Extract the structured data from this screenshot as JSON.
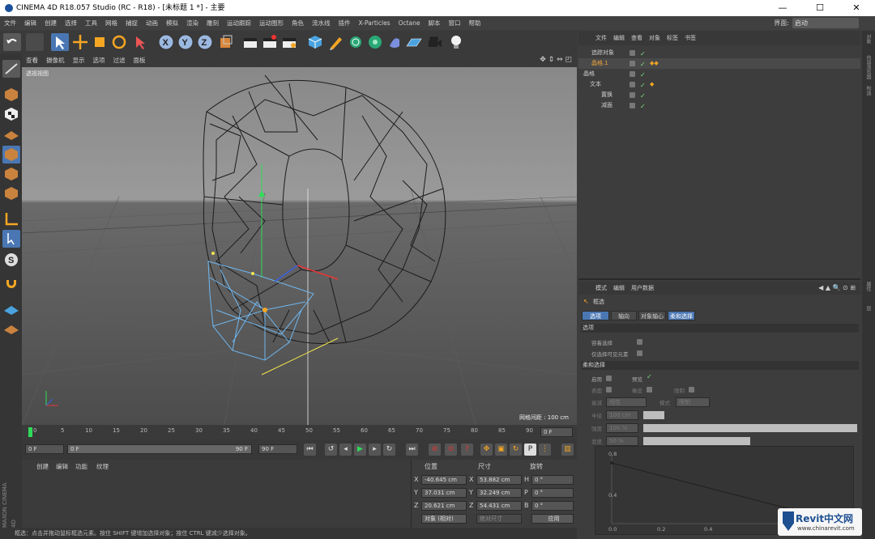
{
  "titlebar": {
    "title": "CINEMA 4D R18.057 Studio (RC - R18) - [未标题 1 *] - 主要",
    "minimize": "—",
    "maximize": "☐",
    "close": "✕"
  },
  "menubar": {
    "items": [
      "文件",
      "编辑",
      "创建",
      "选择",
      "工具",
      "网格",
      "捕捉",
      "动画",
      "模拟",
      "渲染",
      "雕刻",
      "运动跟踪",
      "运动图形",
      "角色",
      "流水线",
      "插件",
      "X-Particles",
      "Octane",
      "脚本",
      "窗口",
      "帮助"
    ],
    "interface_label": "界面:",
    "interface_value": "启动"
  },
  "viewport": {
    "menu": [
      "查看",
      "摄像机",
      "显示",
      "选项",
      "过滤",
      "面板"
    ],
    "label": "透视视图",
    "grid_spacing": "网格间距 : 100 cm"
  },
  "timeline": {
    "ticks": [
      "0",
      "5",
      "10",
      "15",
      "20",
      "25",
      "30",
      "35",
      "40",
      "45",
      "50",
      "55",
      "60",
      "65",
      "70",
      "75",
      "80",
      "85",
      "90"
    ],
    "current": "0 F"
  },
  "playback": {
    "start": "0 F",
    "range_start": "0 F",
    "range_end": "90 F",
    "end": "90 F"
  },
  "material": {
    "menu": [
      "创建",
      "编辑",
      "功能",
      "纹理"
    ]
  },
  "coordinates": {
    "headers": [
      "位置",
      "尺寸",
      "旋转"
    ],
    "rows": [
      {
        "a": "X",
        "pos": "-40.645 cm",
        "b": "X",
        "size": "53.882 cm",
        "c": "H",
        "rot": "0 °"
      },
      {
        "a": "Y",
        "pos": "37.031 cm",
        "b": "Y",
        "size": "32.249 cm",
        "c": "P",
        "rot": "0 °"
      },
      {
        "a": "Z",
        "pos": "20.621 cm",
        "b": "Z",
        "size": "54.431 cm",
        "c": "B",
        "rot": "0 °"
      }
    ],
    "mode": "对象 (相对)",
    "size_mode": "绝对尺寸",
    "apply": "应用"
  },
  "status": "框选：点击并拖动鼠标框选元素。按住 SHIFT 键增加选择对象；按住 CTRL 键减少选择对象。",
  "objects": {
    "menu": [
      "文件",
      "编辑",
      "查看",
      "对象",
      "标签",
      "书签"
    ],
    "items": [
      {
        "name": "追踪对象",
        "indent": 16,
        "color": "#cfcfcf"
      },
      {
        "name": "晶格.1",
        "indent": 16,
        "color": "#f2a63a"
      },
      {
        "name": "晶格",
        "indent": 6,
        "color": "#cfcfcf"
      },
      {
        "name": "文本",
        "indent": 14,
        "color": "#cfcfcf"
      },
      {
        "name": "置换",
        "indent": 28,
        "color": "#cfcfcf"
      },
      {
        "name": "减面",
        "indent": 28,
        "color": "#cfcfcf"
      }
    ]
  },
  "attributes": {
    "menu": [
      "模式",
      "编辑",
      "用户数据"
    ],
    "tool": "框选",
    "tabs": [
      "选项",
      "轴向",
      "对象轴心",
      "柔和选择"
    ],
    "section1": "选项",
    "p_visible": "容着选择",
    "p_only_visible": "仅选择可见元素",
    "section2": "柔和选择",
    "enable": "启用",
    "preview": "预览",
    "surface": "表面",
    "rubber": "橡皮",
    "restrict": "限制",
    "mode_label": "模式",
    "mode_val": "限制",
    "falloff_label": "衰减",
    "falloff_val": "线性",
    "radius_label": "半径",
    "radius_val": "100 cm",
    "strength_label": "强度",
    "strength_val": "100 %",
    "width_label": "宽度",
    "width_val": "50 %",
    "curve_labels": [
      "0.0",
      "0.2",
      "0.4",
      "0.8",
      "0.4"
    ]
  },
  "right_tabs": [
    "对象",
    "内容浏览器",
    "构造",
    "属性",
    "层"
  ],
  "branding": {
    "maxon": "MAXON CINEMA 4D",
    "watermark_title": "Revit中文网",
    "watermark_url": "www.chinarevit.com"
  }
}
